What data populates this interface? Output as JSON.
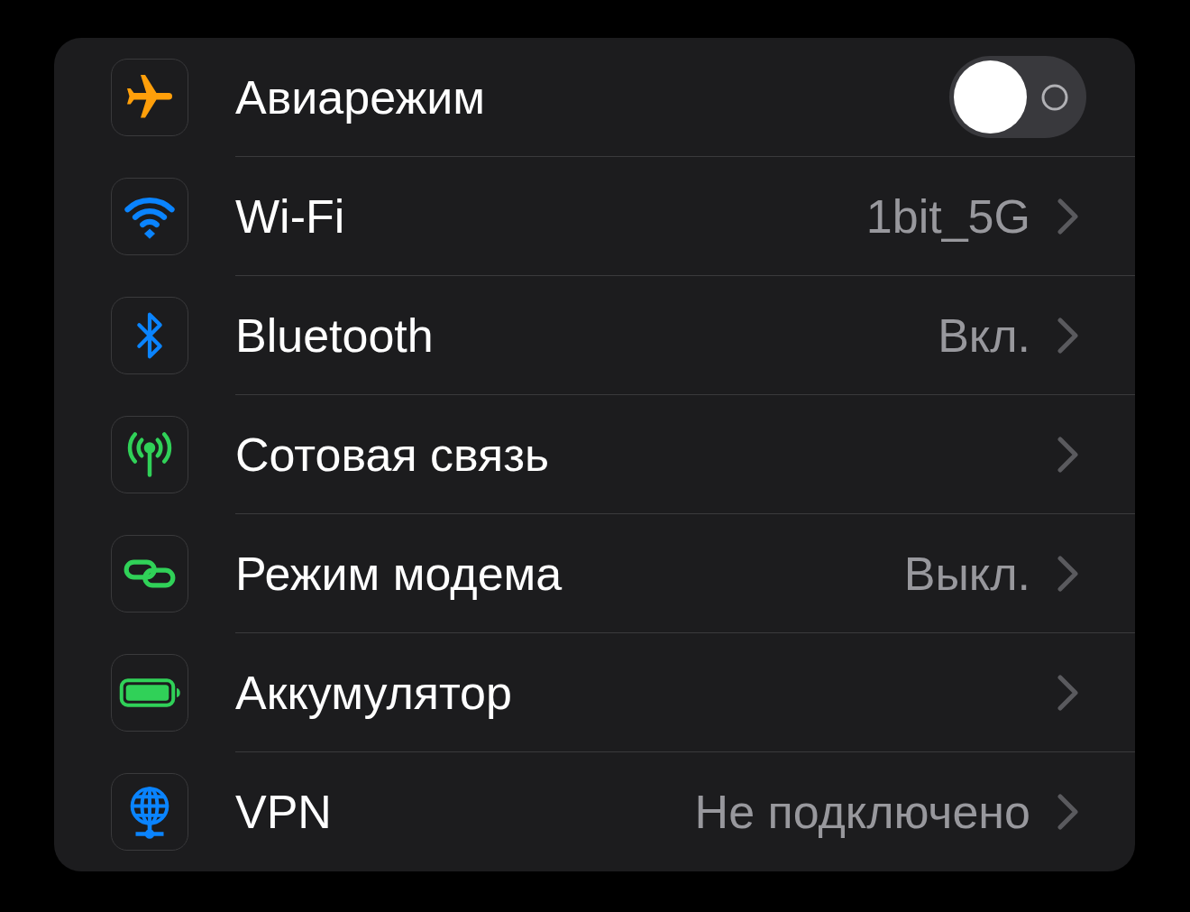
{
  "rows": [
    {
      "kind": "toggle",
      "label": "Авиарежим",
      "on": false
    },
    {
      "kind": "link",
      "label": "Wi-Fi",
      "value": "1bit_5G"
    },
    {
      "kind": "link",
      "label": "Bluetooth",
      "value": "Вкл."
    },
    {
      "kind": "link",
      "label": "Сотовая связь"
    },
    {
      "kind": "link",
      "label": "Режим модема",
      "value": "Выкл."
    },
    {
      "kind": "link",
      "label": "Аккумулятор"
    },
    {
      "kind": "link",
      "label": "VPN",
      "value": "Не подключено"
    }
  ]
}
